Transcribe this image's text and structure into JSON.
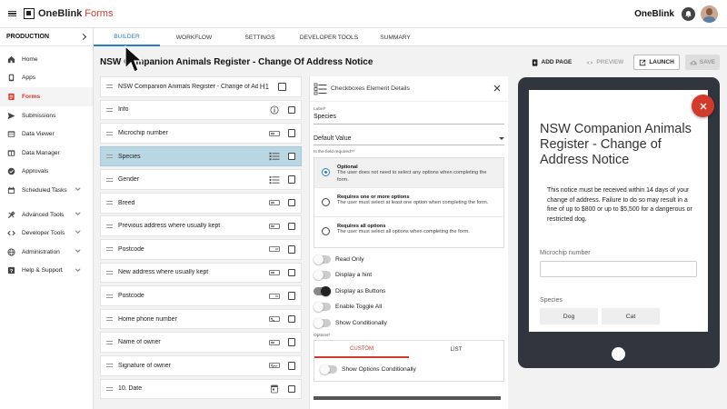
{
  "brand": {
    "name_bold": "OneBlink",
    "name_light": "Forms"
  },
  "header": {
    "org_name": "OneBlink"
  },
  "sidebar": {
    "environment": "PRODUCTION",
    "items": [
      {
        "label": "Home",
        "icon": "home-icon"
      },
      {
        "label": "Apps",
        "icon": "apps-icon"
      },
      {
        "label": "Forms",
        "icon": "forms-icon",
        "active": true
      },
      {
        "label": "Submissions",
        "icon": "submissions-icon"
      },
      {
        "label": "Data Viewer",
        "icon": "data-viewer-icon"
      },
      {
        "label": "Data Manager",
        "icon": "data-manager-icon"
      },
      {
        "label": "Approvals",
        "icon": "approvals-icon"
      },
      {
        "label": "Scheduled Tasks",
        "icon": "scheduled-tasks-icon"
      }
    ],
    "groups": [
      {
        "label": "Advanced Tools",
        "icon": "tools-icon"
      },
      {
        "label": "Developer Tools",
        "icon": "code-icon"
      },
      {
        "label": "Administration",
        "icon": "globe-icon"
      },
      {
        "label": "Help & Support",
        "icon": "help-icon"
      }
    ]
  },
  "tabs": [
    "BUILDER",
    "WORKFLOW",
    "SETTINGS",
    "DEVELOPER TOOLS",
    "SUMMARY"
  ],
  "form": {
    "title": "NSW Companion Animals Register - Change Of Address Notice"
  },
  "actions": {
    "add_page": "ADD PAGE",
    "preview": "PREVIEW",
    "launch": "LAUNCH",
    "save": "SAVE"
  },
  "elements": [
    {
      "label": "NSW Companion Animals Register - Change of Address Notice",
      "icon": "heading-icon",
      "icon_text": "H1"
    },
    {
      "label": "Info",
      "icon": "info-icon"
    },
    {
      "label": "Microchip number",
      "icon": "text-field-icon"
    },
    {
      "label": "Species",
      "icon": "checkbox-list-icon",
      "selected": true
    },
    {
      "label": "Gender",
      "icon": "radio-list-icon"
    },
    {
      "label": "Breed",
      "icon": "text-field-icon"
    },
    {
      "label": "Previous address where usually kept",
      "icon": "text-field-icon"
    },
    {
      "label": "Postcode",
      "icon": "number-field-icon"
    },
    {
      "label": "New address where usually kept",
      "icon": "text-field-icon"
    },
    {
      "label": "Postcode",
      "icon": "number-field-icon"
    },
    {
      "label": "Home phone number",
      "icon": "phone-icon"
    },
    {
      "label": "Name of owner",
      "icon": "text-field-icon"
    },
    {
      "label": "Signature of owner",
      "icon": "signature-icon"
    },
    {
      "label": "10. Date",
      "icon": "calendar-icon"
    }
  ],
  "details": {
    "title": "Checkboxes Element Details",
    "label_caption": "Label*",
    "label_value": "Species",
    "default_value_placeholder": "Default Value",
    "required_caption": "Is the field required?*",
    "options": [
      {
        "title": "Optional",
        "desc": "The user does not need to select any options when completing the form.",
        "selected": true
      },
      {
        "title": "Requires one or more options",
        "desc": "The user must select at least one option when completing the form."
      },
      {
        "title": "Requires all options",
        "desc": "The user must select all options when completing the form."
      }
    ],
    "toggles": [
      {
        "label": "Read Only",
        "on": false
      },
      {
        "label": "Display a hint",
        "on": false
      },
      {
        "label": "Display as Buttons",
        "on": true
      },
      {
        "label": "Enable Toggle All",
        "on": false
      },
      {
        "label": "Show Conditionally",
        "on": false
      }
    ],
    "options_caption": "Options*",
    "option_tabs": [
      "CUSTOM",
      "LIST"
    ],
    "show_options_conditionally": "Show Options Conditionally"
  },
  "preview": {
    "title": "NSW Companion Animals Register - Change of Address Notice",
    "notice": "This notice must be received within 14 days of your change of address. Failure to do so may result in a fine of up to $800 or up to $5,500 for a dangerous or restricted dog.",
    "microchip_label": "Microchip number",
    "species_label": "Species",
    "species_options": [
      "Dog",
      "Cat"
    ]
  },
  "colors": {
    "accent": "#2a7fc4",
    "brand": "#d33a2c",
    "selected_row": "#b9d6e3",
    "tablet": "#30353e"
  }
}
